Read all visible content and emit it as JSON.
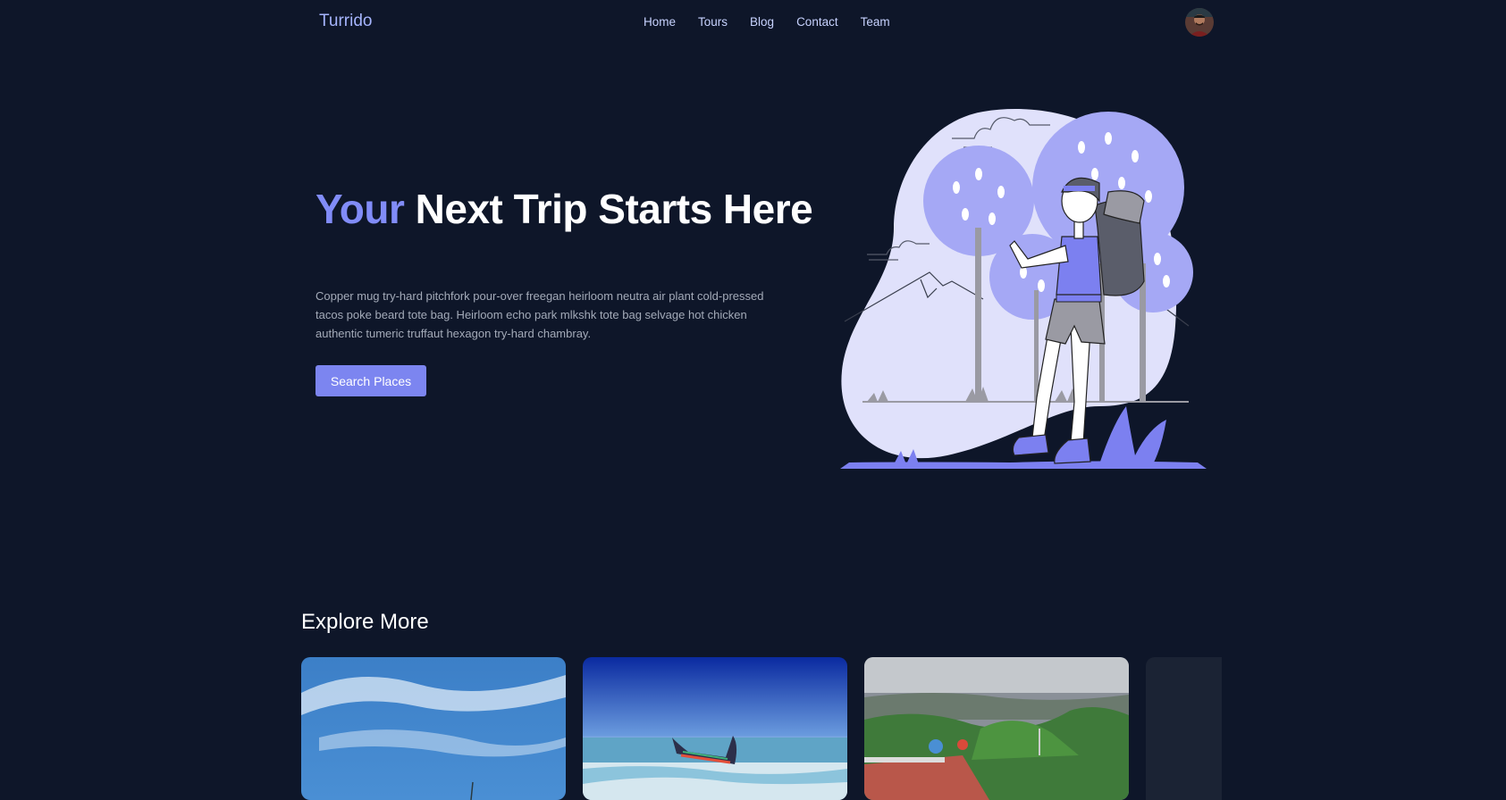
{
  "nav": {
    "brand": "Turrido",
    "links": [
      "Home",
      "Tours",
      "Blog",
      "Contact",
      "Team"
    ]
  },
  "hero": {
    "title_accent": "Your",
    "title_rest": "Next Trip Starts Here",
    "description": "Copper mug try-hard pitchfork pour-over freegan heirloom neutra air plant cold-pressed tacos poke beard tote bag. Heirloom echo park mlkshk tote bag selvage hot chicken authentic tumeric truffaut hexagon try-hard chambray.",
    "cta": "Search Places"
  },
  "explore": {
    "title": "Explore More",
    "cards": [
      {
        "image": "sky-with-clouds-photo"
      },
      {
        "image": "boat-on-beach-photo"
      },
      {
        "image": "green-hills-viewpoint-photo"
      },
      {
        "image": "partial-card"
      }
    ]
  },
  "colors": {
    "background": "#0e1629",
    "accent": "#818cf8",
    "brand": "#a5b4fc",
    "button": "#7c85f0",
    "blob": "#e0e1fb"
  },
  "icons": {
    "avatar": "user-avatar",
    "hero_image": "backpacker-illustration"
  }
}
